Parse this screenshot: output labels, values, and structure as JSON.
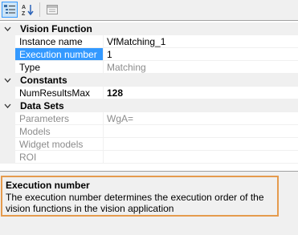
{
  "toolbar": {
    "buttons": [
      {
        "icon": "categorized-icon",
        "active": true
      },
      {
        "icon": "sort-alphabetical-icon",
        "label": "AZ",
        "active": false
      },
      {
        "icon": "property-pages-icon",
        "active": false
      }
    ]
  },
  "categories": [
    {
      "label": "Vision Function",
      "properties": [
        {
          "name": "Instance name",
          "value": "VfMatching_1"
        },
        {
          "name": "Execution number",
          "value": "1"
        },
        {
          "name": "Type",
          "value": "Matching"
        }
      ]
    },
    {
      "label": "Constants",
      "properties": [
        {
          "name": "NumResultsMax",
          "value": "128"
        }
      ]
    },
    {
      "label": "Data Sets",
      "properties": [
        {
          "name": "Parameters",
          "value": "WgA="
        },
        {
          "name": "Models",
          "value": ""
        },
        {
          "name": "Widget models",
          "value": ""
        },
        {
          "name": "ROI",
          "value": ""
        }
      ]
    }
  ],
  "help": {
    "title": "Execution number",
    "description": "The execution number determines the execution order of the vision functions in the vision application"
  },
  "colors": {
    "selection": "#3399ff",
    "help_border": "#e59b4d",
    "disabled_text": "#8c8c8c"
  }
}
